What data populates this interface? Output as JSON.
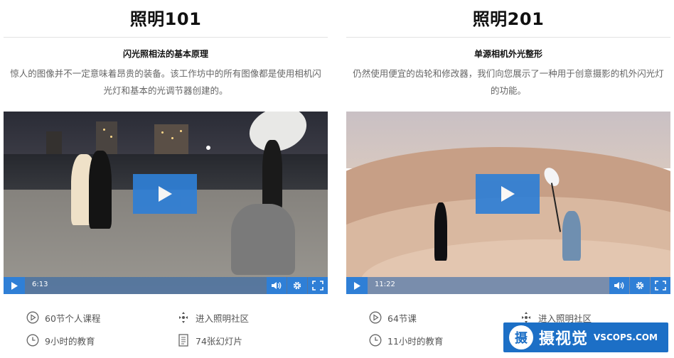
{
  "courses": [
    {
      "title": "照明101",
      "subtitle": "闪光照相法的基本原理",
      "description": "惊人的图像并不一定意味着昂贵的装备。该工作坊中的所有图像都是使用相机闪光灯和基本的光调节器创建的。",
      "video": {
        "time": "6:13",
        "scene": "night-city-shoot"
      },
      "meta": {
        "lessons": "60节个人课程",
        "community": "进入照明社区",
        "hours": "9小时的教育",
        "slides": "74张幻灯片"
      }
    },
    {
      "title": "照明201",
      "subtitle": "单源相机外光整形",
      "description": "仍然使用便宜的齿轮和修改器，我们向您展示了一种用于创意摄影的机外闪光灯的功能。",
      "video": {
        "time": "11:22",
        "scene": "desert-dune-shoot"
      },
      "meta": {
        "lessons": "64节课",
        "community": "进入照明社区",
        "hours": "11小时的教育"
      }
    }
  ],
  "watermark": {
    "logo_char": "摄",
    "cn": "摄视觉",
    "en": "VSCOPS.COM"
  },
  "colors": {
    "accent": "#2f7fd6",
    "watermark_bg": "#1c6fc6"
  },
  "icons": {
    "lessons": "play-circle-icon",
    "community": "community-icon",
    "hours": "clock-icon",
    "slides": "slides-icon",
    "volume": "volume-icon",
    "settings": "gear-icon",
    "fullscreen": "fullscreen-icon"
  }
}
